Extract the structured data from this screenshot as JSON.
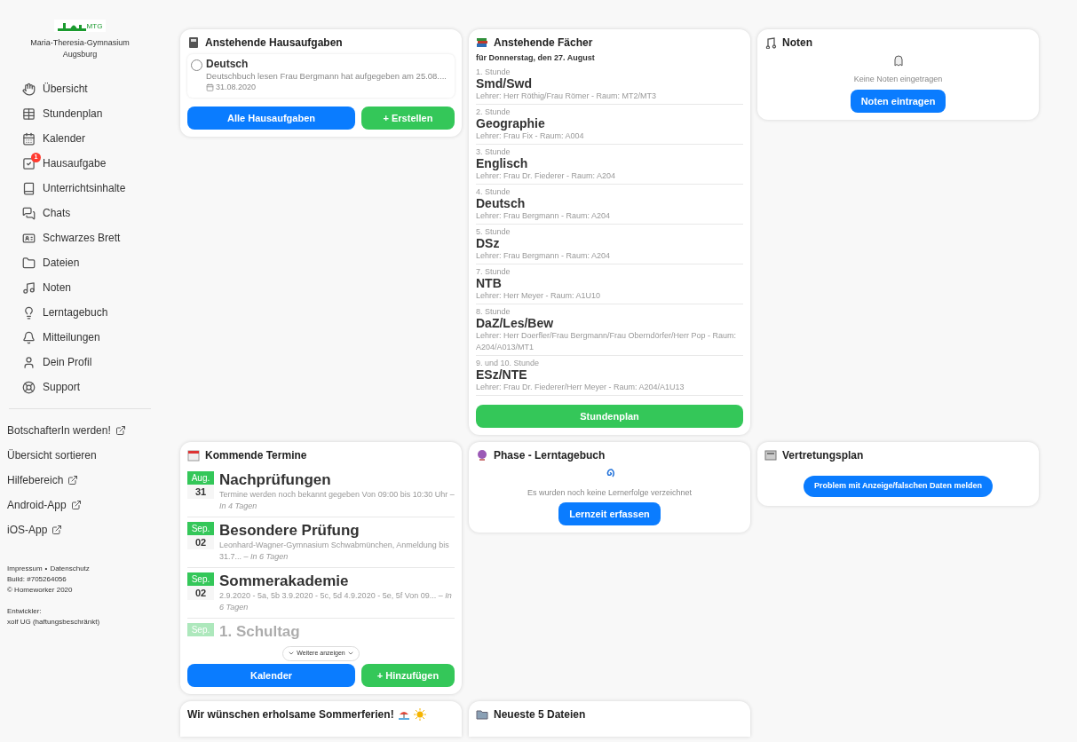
{
  "sidebar": {
    "logo_text": "MTG",
    "school": "Maria-Theresia-Gymnasium Augsburg",
    "nav": [
      {
        "label": "Übersicht",
        "selected": false
      },
      {
        "label": "Stundenplan",
        "selected": false
      },
      {
        "label": "Kalender",
        "selected": false
      },
      {
        "label": "Hausaufgabe",
        "selected": false,
        "badge": "1"
      },
      {
        "label": "Unterrichtsinhalte",
        "selected": false
      },
      {
        "label": "Chats",
        "selected": false
      },
      {
        "label": "Schwarzes Brett",
        "selected": false
      },
      {
        "label": "Dateien",
        "selected": false
      },
      {
        "label": "Noten",
        "selected": false
      },
      {
        "label": "Lerntagebuch",
        "selected": false
      },
      {
        "label": "Mitteilungen",
        "selected": false
      },
      {
        "label": "Dein Profil",
        "selected": false
      },
      {
        "label": "Support",
        "selected": false
      }
    ],
    "links": [
      {
        "label": "BotschafterIn werden!",
        "external": true
      },
      {
        "label": "Übersicht sortieren",
        "external": false
      },
      {
        "label": "Hilfebereich",
        "external": true
      },
      {
        "label": "Android-App",
        "external": true
      },
      {
        "label": "iOS-App",
        "external": true
      }
    ],
    "footer": {
      "links": [
        "Impressum",
        "Datenschutz"
      ],
      "separator": "•",
      "lines": [
        "Build: #705264056",
        "© Homeworker 2020"
      ],
      "developer_label": "Entwickler:",
      "developer": "xolf UG (haftungsbeschränkt)"
    }
  },
  "homework": {
    "title": "Anstehende Hausaufgaben",
    "items": [
      {
        "subject": "Deutsch",
        "text": "Deutschbuch lesen Frau Bergmann hat aufgegeben am 25.08....",
        "due": "31.08.2020",
        "checked": false
      }
    ],
    "buttons": [
      {
        "label": "Alle Hausaufgaben",
        "kind": "primary"
      },
      {
        "label": "+ Erstellen",
        "kind": "success"
      }
    ]
  },
  "subjects": {
    "title": "Anstehende Fächer",
    "subtitle": "für Donnerstag, den 27. August",
    "lessons": [
      {
        "period": "1. Stunde",
        "subject": "Smd/Swd",
        "info": "Lehrer: Herr Röthig/Frau Römer - Raum: MT2/MT3"
      },
      {
        "period": "2. Stunde",
        "subject": "Geographie",
        "info": "Lehrer: Frau Fix - Raum: A004"
      },
      {
        "period": "3. Stunde",
        "subject": "Englisch",
        "info": "Lehrer: Frau Dr. Fiederer - Raum: A204"
      },
      {
        "period": "4. Stunde",
        "subject": "Deutsch",
        "info": "Lehrer: Frau Bergmann - Raum: A204"
      },
      {
        "period": "5. Stunde",
        "subject": "DSz",
        "info": "Lehrer: Frau Bergmann - Raum: A204"
      },
      {
        "period": "7. Stunde",
        "subject": "NTB",
        "info": "Lehrer: Herr Meyer - Raum: A1U10"
      },
      {
        "period": "8. Stunde",
        "subject": "DaZ/Les/Bew",
        "info": "Lehrer: Herr Doerfler/Frau Bergmann/Frau Oberndörfer/Herr Pop - Raum: A204/A013/MT1"
      },
      {
        "period": "9. und 10. Stunde",
        "subject": "ESz/NTE",
        "info": "Lehrer: Frau Dr. Fiederer/Herr Meyer - Raum: A204/A1U13"
      }
    ],
    "button": {
      "label": "Stundenplan",
      "kind": "success"
    }
  },
  "grades": {
    "title": "Noten",
    "empty_text": "Keine Noten eingetragen",
    "button": {
      "label": "Noten eintragen",
      "kind": "primary"
    }
  },
  "events": {
    "title": "Kommende Termine",
    "items": [
      {
        "month": "Aug.",
        "day": "31",
        "title": "Nachprüfungen",
        "text": "Termine werden noch bekannt gegeben Von 09:00 bis 10:30 Uhr – *In 4 Tagen*",
        "faded": false
      },
      {
        "month": "Sep.",
        "day": "02",
        "title": "Besondere Prüfung",
        "text": "Leonhard-Wagner-Gymnasium Schwabmünchen, Anmeldung bis 31.7... – *In 6 Tagen*",
        "faded": false
      },
      {
        "month": "Sep.",
        "day": "02",
        "title": "Sommerakademie",
        "text": "2.9.2020 - 5a, 5b 3.9.2020 - 5c, 5d 4.9.2020 - 5e, 5f Von 09... – *In 6 Tagen*",
        "faded": false
      },
      {
        "month": "Sep.",
        "title": "1. Schultag",
        "faded": true
      }
    ],
    "more": "Weitere anzeigen",
    "buttons": [
      {
        "label": "Kalender",
        "kind": "primary"
      },
      {
        "label": "+ Hinzufügen",
        "kind": "success"
      }
    ]
  },
  "diary": {
    "title": "Phase - Lerntagebuch",
    "empty_text": "Es wurden noch keine Lernerfolge verzeichnet",
    "button": {
      "label": "Lernzeit erfassen",
      "kind": "primary"
    }
  },
  "substitution": {
    "title": "Vertretungsplan",
    "button": {
      "label": "Problem mit Anzeige/falschen Daten melden",
      "kind": "primary"
    }
  },
  "holiday": {
    "title": "Wir wünschen erholsame Sommerferien!"
  },
  "files": {
    "title": "Neueste 5 Dateien"
  }
}
